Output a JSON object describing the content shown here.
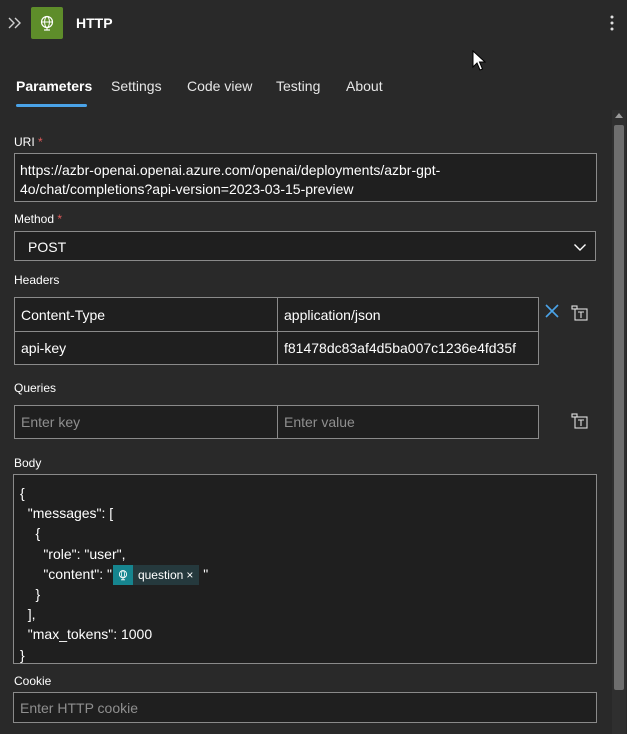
{
  "header": {
    "title": "HTTP"
  },
  "tabs": [
    {
      "label": "Parameters"
    },
    {
      "label": "Settings"
    },
    {
      "label": "Code view"
    },
    {
      "label": "Testing"
    },
    {
      "label": "About"
    }
  ],
  "uri": {
    "label": "URI",
    "required_mark": "*",
    "value_line1": "https://azbr-openai.openai.azure.com/openai/deployments/azbr-gpt-",
    "value_line2": "4o/chat/completions?api-version=2023-03-15-preview"
  },
  "method": {
    "label": "Method",
    "required_mark": "*",
    "value": "POST"
  },
  "headers": {
    "label": "Headers",
    "rows": [
      {
        "key": "Content-Type",
        "value": "application/json"
      },
      {
        "key": "api-key",
        "value": "f81478dc83af4d5ba007c1236e4fd35f"
      }
    ]
  },
  "queries": {
    "label": "Queries",
    "key_placeholder": "Enter key",
    "value_placeholder": "Enter value"
  },
  "body": {
    "label": "Body",
    "lines": [
      "{",
      "  \"messages\": [",
      "    {",
      "      \"role\": \"user\",",
      "      \"content\": \"",
      "    }",
      "  ],",
      "  \"max_tokens\": 1000",
      "}"
    ],
    "token": {
      "label": "question",
      "remove": "×",
      "closing_quote": " \""
    }
  },
  "cookie": {
    "label": "Cookie",
    "placeholder": "Enter HTTP cookie"
  },
  "colors": {
    "background": "#292929",
    "accent": "#4aa3e8",
    "app_icon": "#5e8d2a",
    "token_icon": "#16858f",
    "required": "#e05a5a"
  },
  "icons": [
    "collapse-icon",
    "http-globe-icon",
    "more-options-icon",
    "delete-x-icon",
    "switch-text-mode-icon",
    "chevron-down-icon"
  ]
}
